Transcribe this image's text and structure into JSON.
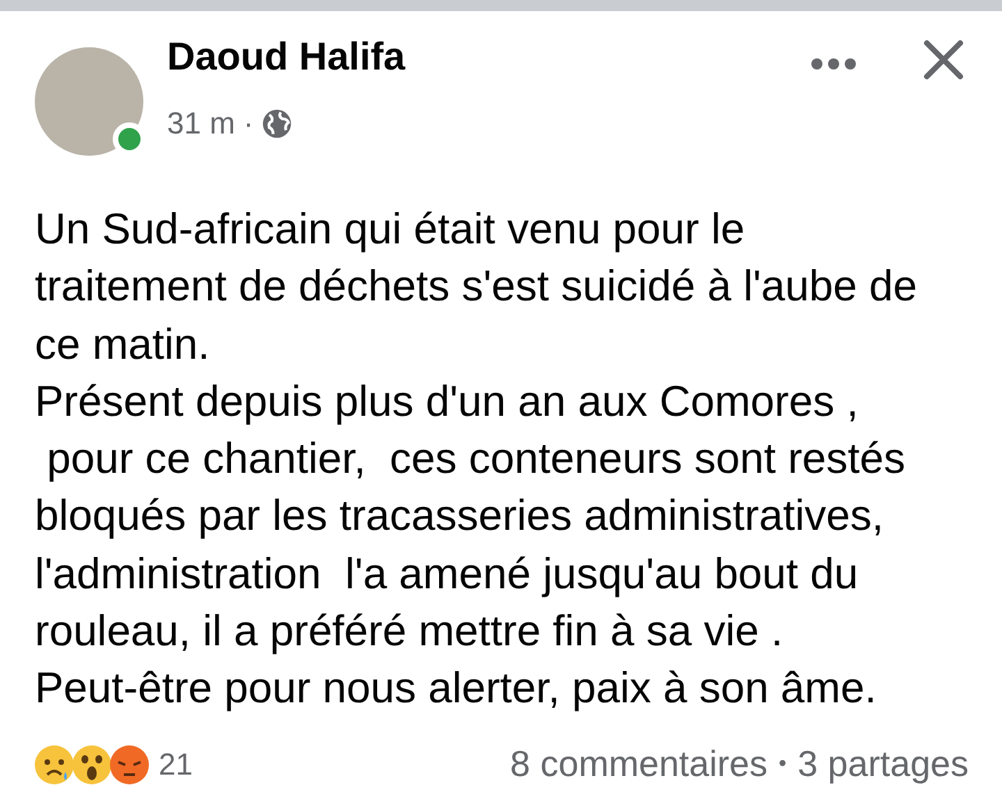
{
  "post": {
    "author": "Daoud Halifa",
    "online": true,
    "time": "31 m",
    "separator": "·",
    "body": "Un Sud-africain qui était venu pour le\ntraitement de déchets s'est suicidé à l'aube de\nce matin.\nPrésent depuis plus d'un an aux Comores ,\n pour ce chantier,  ces conteneurs sont restés\nbloqués par les tracasseries administratives,\nl'administration  l'a amené jusqu'au bout du\nrouleau, il a préféré mettre fin à sa vie .\nPeut-être pour nous alerter, paix à son âme."
  },
  "reactions": [
    {
      "kind": "sad"
    },
    {
      "kind": "wow"
    },
    {
      "kind": "angry"
    }
  ],
  "reaction_count": "21",
  "comments": "8 commentaires",
  "dot": "•",
  "shares": "3 partages"
}
